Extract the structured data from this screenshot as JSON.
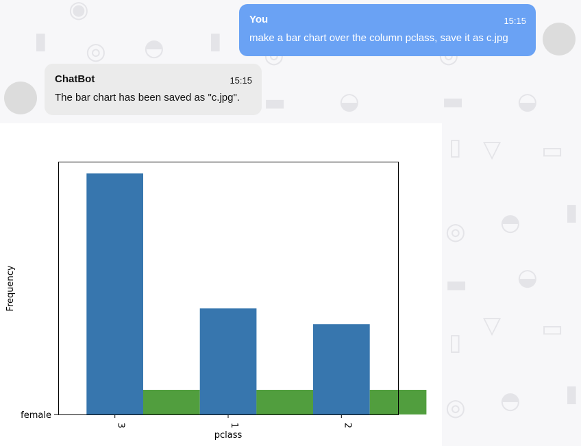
{
  "conversation": {
    "user_message": {
      "sender": "You",
      "time": "15:15",
      "text": "make a bar chart over the column pclass, save it as c.jpg"
    },
    "bot_message": {
      "sender": "ChatBot",
      "time": "15:15",
      "text": "The bar chart has been saved as \"c.jpg\"."
    }
  },
  "colors": {
    "user_bubble": "#6aa2f4",
    "bot_bubble": "#ebebeb",
    "series_blue": "#3776ae",
    "series_green": "#519e3e"
  },
  "background_icons": [
    "popsicle-icon",
    "donut-icon",
    "taco-icon",
    "burger-icon",
    "hotdog-icon",
    "ice-cream-icon",
    "soda-cup-icon",
    "fries-icon"
  ],
  "chart_data": {
    "type": "bar",
    "categories": [
      "3",
      "1",
      "2"
    ],
    "series": [
      {
        "values": [
          491,
          216,
          184
        ],
        "color": "#3776ae"
      },
      {
        "values": [
          1,
          1,
          1
        ],
        "color": "#519e3e"
      }
    ],
    "xlabel": "pclass",
    "ylabel": "Frequency",
    "ytick_label": "female",
    "ylim": [
      0,
      515
    ],
    "grid": false
  }
}
